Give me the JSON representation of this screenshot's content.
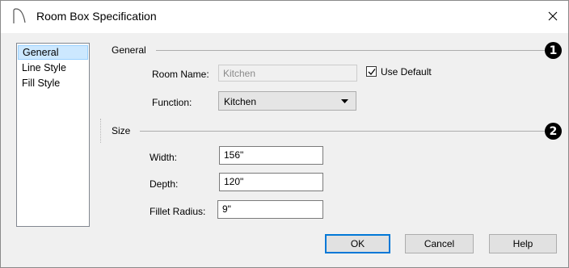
{
  "window": {
    "title": "Room Box Specification",
    "close_glyph": "✕"
  },
  "nav": {
    "items": [
      {
        "label": "General",
        "selected": true
      },
      {
        "label": "Line Style",
        "selected": false
      },
      {
        "label": "Fill Style",
        "selected": false
      }
    ]
  },
  "general": {
    "group_title": "General",
    "marker": "1",
    "room_name_label": "Room Name:",
    "room_name_value": "Kitchen",
    "use_default_label": "Use Default",
    "use_default_checked": true,
    "function_label": "Function:",
    "function_value": "Kitchen"
  },
  "size": {
    "group_title": "Size",
    "marker": "2",
    "width_label": "Width:",
    "width_value": "156\"",
    "depth_label": "Depth:",
    "depth_value": "120\"",
    "fillet_label": "Fillet Radius:",
    "fillet_value": "9\""
  },
  "buttons": {
    "ok": "OK",
    "cancel": "Cancel",
    "help": "Help"
  },
  "colors": {
    "selection_bg": "#cce8ff",
    "default_button_border": "#0078d7"
  }
}
